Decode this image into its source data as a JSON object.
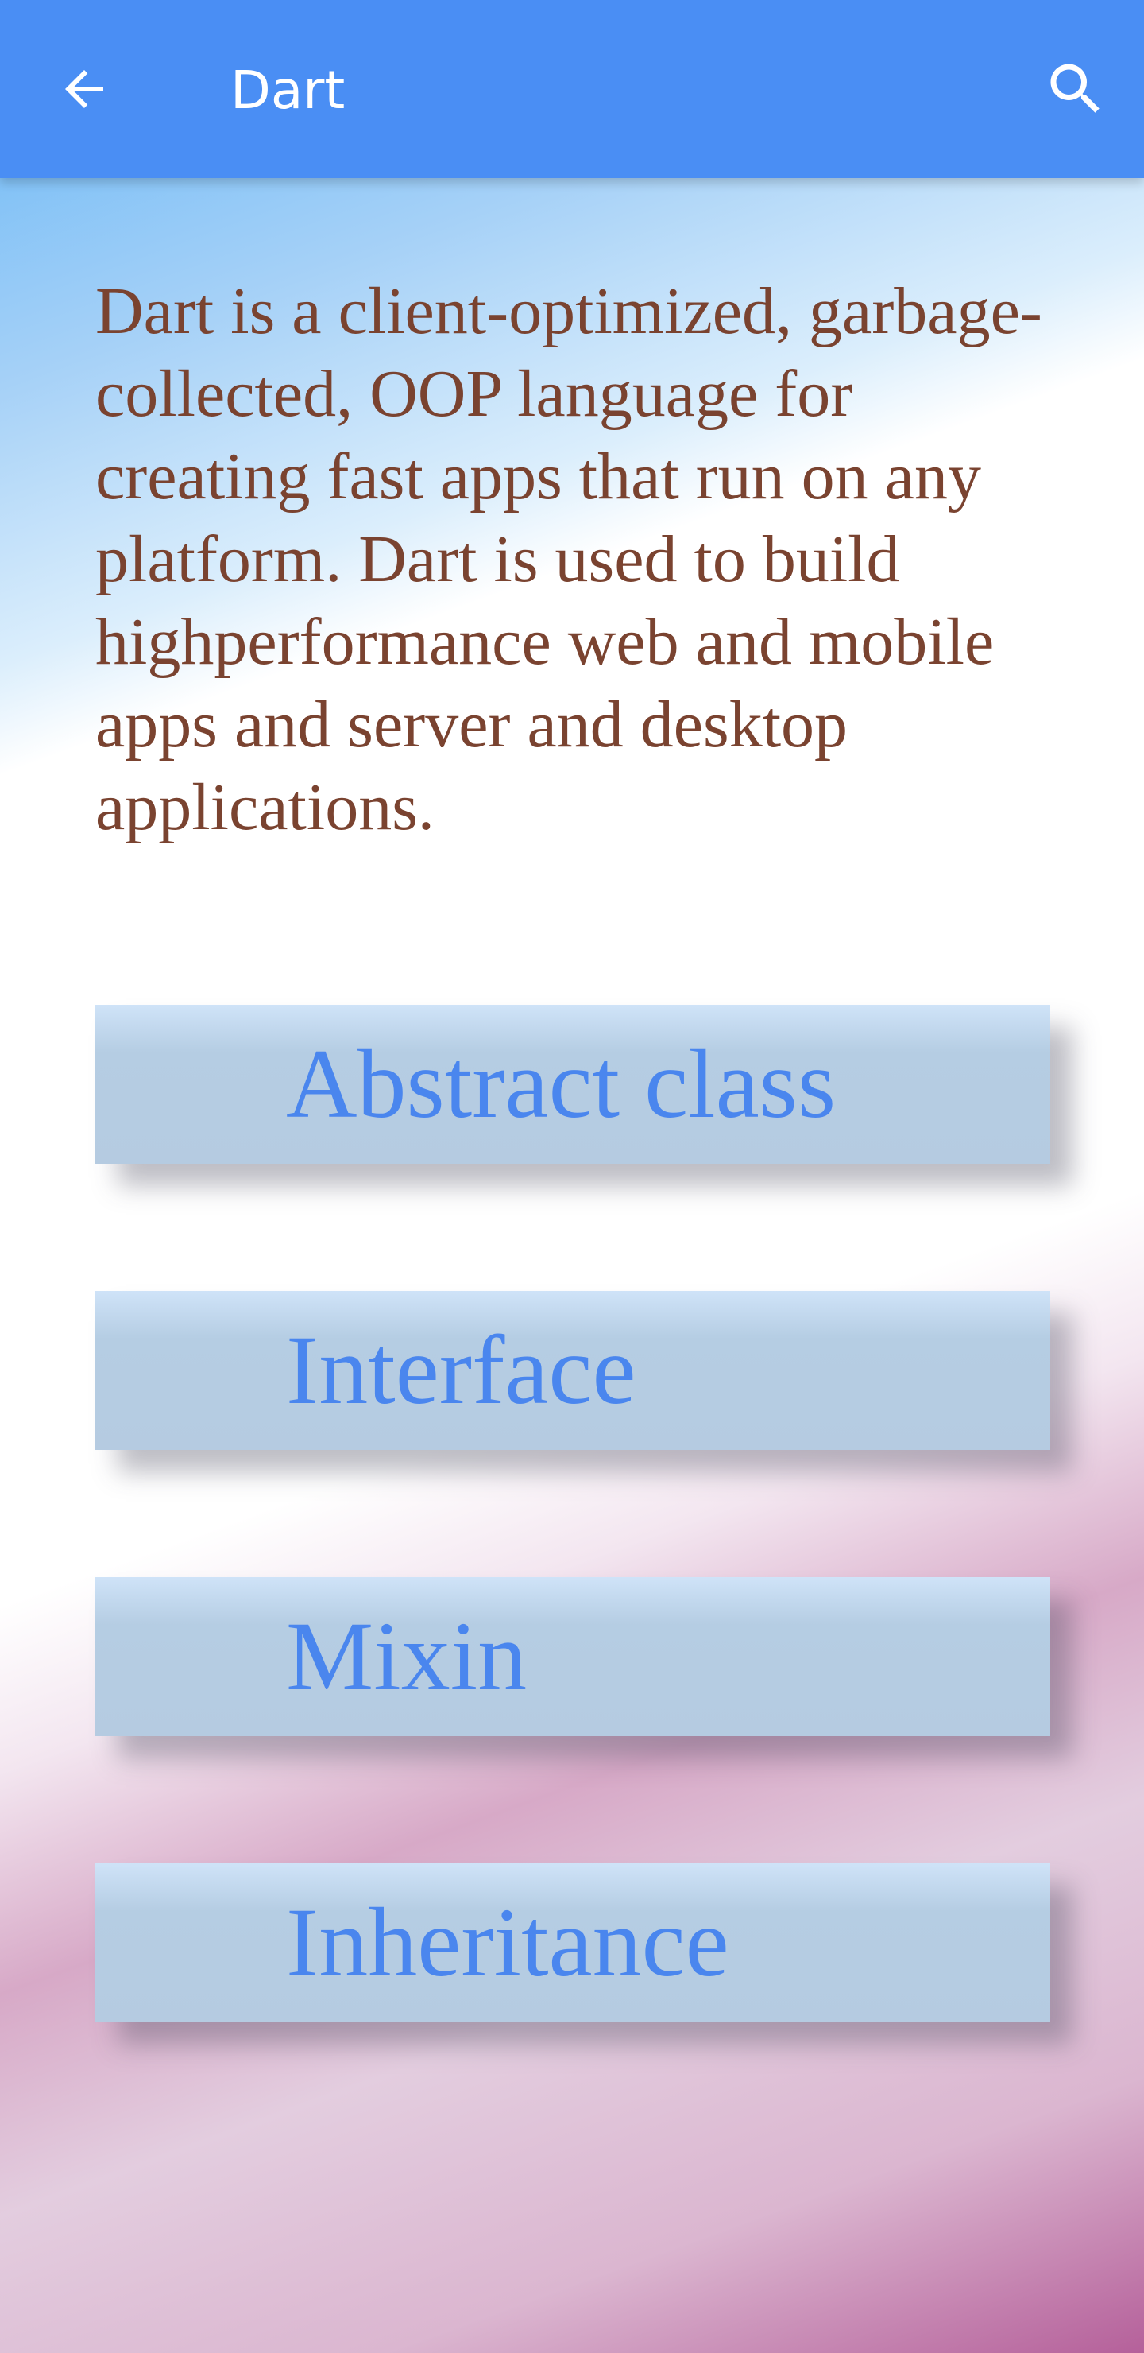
{
  "app_bar": {
    "title": "Dart",
    "back_icon": "arrow-back-icon",
    "search_icon": "search-icon",
    "color": "#4a8ef4"
  },
  "description": "Dart is a client-optimized, garbage-collected, OOP language for creating fast apps that run on any platform. Dart is used to build highperformance web and mobile apps and server and desktop applications.",
  "topics": [
    {
      "label": "Abstract class"
    },
    {
      "label": "Interface"
    },
    {
      "label": "Mixin"
    },
    {
      "label": "Inheritance"
    }
  ],
  "colors": {
    "description_text": "#7a4330",
    "button_text": "#4a86ee",
    "button_bg": "#b5cbe1"
  }
}
